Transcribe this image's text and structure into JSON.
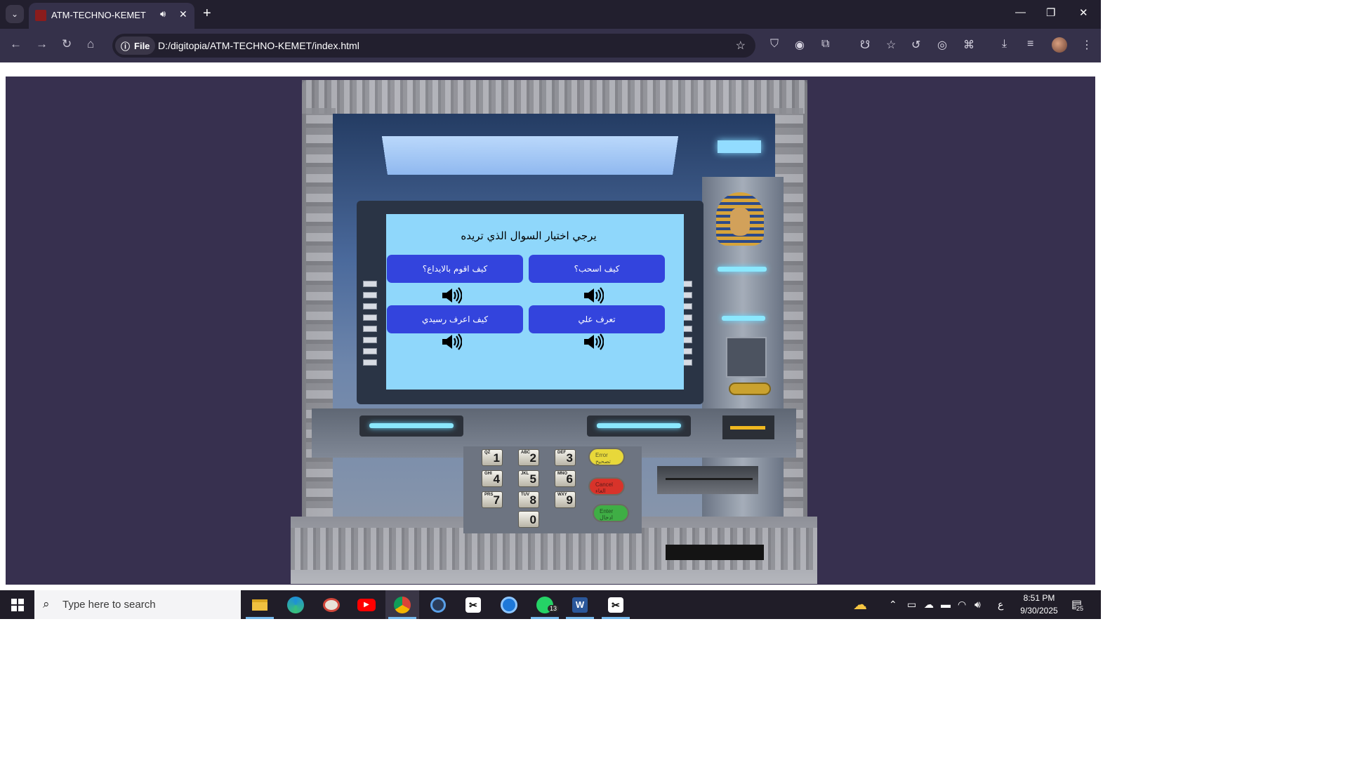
{
  "browser": {
    "tab": {
      "title": "ATM-TECHNO-KEMET"
    },
    "omnibox": {
      "chip": "File",
      "url": "D:/digitopia/ATM-TECHNO-KEMET/index.html"
    }
  },
  "atm_screen": {
    "prompt": "يرجي اختيار السوال الذي تريده",
    "buttons": [
      {
        "label": "كيف اسحب؟"
      },
      {
        "label": "كيف اقوم بالايداع؟"
      },
      {
        "label": "تعرف علي"
      },
      {
        "label": "كيف اعرف رسيدي"
      }
    ]
  },
  "keypad": {
    "keys": [
      {
        "digit": "1",
        "letters": "QZ"
      },
      {
        "digit": "2",
        "letters": "ABC"
      },
      {
        "digit": "3",
        "letters": "DEF"
      },
      {
        "digit": "4",
        "letters": "GHI"
      },
      {
        "digit": "5",
        "letters": "JKL"
      },
      {
        "digit": "6",
        "letters": "MNO"
      },
      {
        "digit": "7",
        "letters": "PRS"
      },
      {
        "digit": "8",
        "letters": "TUV"
      },
      {
        "digit": "9",
        "letters": "WXY"
      },
      {
        "digit": "0",
        "letters": ""
      }
    ],
    "function_keys": [
      {
        "label": "Error",
        "sub": "تصحيح",
        "color": "#e8d83a"
      },
      {
        "label": "Cancel",
        "sub": "الغاء",
        "color": "#d8332a"
      },
      {
        "label": "Enter",
        "sub": "ادخال",
        "color": "#3fae45"
      }
    ]
  },
  "taskbar": {
    "search_placeholder": "Type here to search",
    "whatsapp_badge": "13",
    "language": "ع",
    "time": "8:51 PM",
    "date": "9/30/2025",
    "notifications": "25"
  },
  "colors": {
    "page_background": "#37304f",
    "question_button": "#3344dd",
    "atm_screen": "#8fd7fb"
  }
}
